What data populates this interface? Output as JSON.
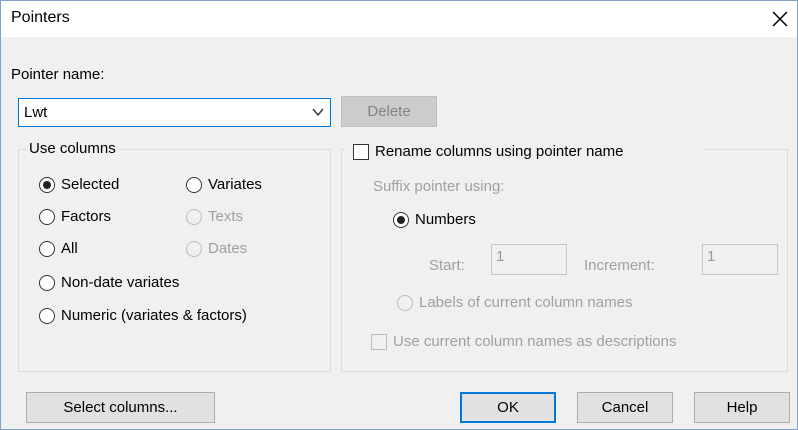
{
  "window": {
    "title": "Pointers"
  },
  "pointer_name": {
    "label": "Pointer name:",
    "value": "Lwt"
  },
  "buttons": {
    "delete": "Delete",
    "select_columns": "Select columns...",
    "ok": "OK",
    "cancel": "Cancel",
    "help": "Help"
  },
  "use_columns": {
    "legend": "Use columns",
    "options": {
      "selected": {
        "label": "Selected",
        "checked": true,
        "enabled": true
      },
      "variates": {
        "label": "Variates",
        "checked": false,
        "enabled": true
      },
      "factors": {
        "label": "Factors",
        "checked": false,
        "enabled": true
      },
      "texts": {
        "label": "Texts",
        "checked": false,
        "enabled": false
      },
      "all": {
        "label": "All",
        "checked": false,
        "enabled": true
      },
      "dates": {
        "label": "Dates",
        "checked": false,
        "enabled": false
      },
      "non_date_variates": {
        "label": "Non-date variates",
        "checked": false,
        "enabled": true
      },
      "numeric": {
        "label": "Numeric (variates & factors)",
        "checked": false,
        "enabled": true
      }
    }
  },
  "rename": {
    "checkbox_label": "Rename columns using pointer name",
    "checked": false,
    "suffix_label": "Suffix pointer using:",
    "numbers_label": "Numbers",
    "numbers_checked": true,
    "start_label": "Start:",
    "start_value": "1",
    "increment_label": "Increment:",
    "increment_value": "1",
    "labels_option": "Labels of current column names",
    "use_descriptions_label": "Use current column names as descriptions",
    "use_descriptions_checked": false
  }
}
